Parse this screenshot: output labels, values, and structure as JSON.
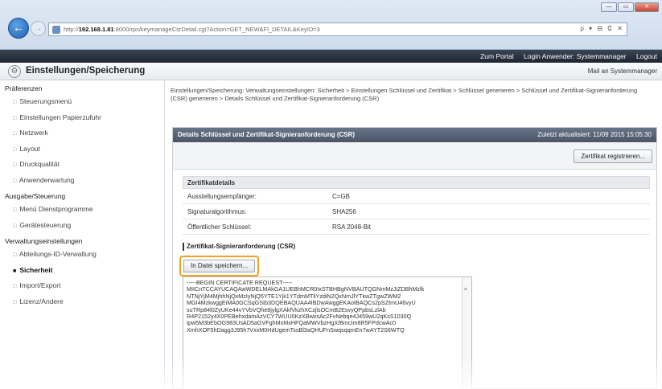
{
  "browser": {
    "url_prefix": "http://",
    "url_host": "192.168.1.81",
    "url_rest": ":8000/rps/keymanageCsrDetail.cgi?Action=GET_NEW&Fl_DETAIL&KeyID=3",
    "addr_tools": "ρ ▾ ⊟ ₵ ✕",
    "win_minimize": "—",
    "win_maximize": "▭",
    "win_close": "✕"
  },
  "portal": {
    "left_dim": "",
    "portal_link": "Zum Portal",
    "login_user": "Login Anwender: Systemmanager",
    "logout": "Logout"
  },
  "header": {
    "title": "Einstellungen/Speicherung",
    "mail": "Mail an Systemmanager"
  },
  "sidebar": {
    "groups": [
      {
        "title": "Präferenzen",
        "items": [
          {
            "label": "Steuerungsmenü"
          },
          {
            "label": "Einstellungen Papierzufuhr"
          },
          {
            "label": "Netzwerk"
          },
          {
            "label": "Layout"
          },
          {
            "label": "Druckqualität"
          },
          {
            "label": "Anwenderwartung"
          }
        ]
      },
      {
        "title": "Ausgabe/Steuerung",
        "items": [
          {
            "label": "Menü Dienstprogramme"
          },
          {
            "label": "Gerätesteuerung"
          }
        ]
      },
      {
        "title": "Verwaltungseinstellungen",
        "items": [
          {
            "label": "Abteilungs-ID-Verwaltung"
          },
          {
            "label": "Sicherheit"
          },
          {
            "label": "Import/Export"
          },
          {
            "label": "Lizenz/Andere"
          }
        ]
      }
    ]
  },
  "main": {
    "breadcrumb": "Einstellungen/Speicherung: Verwaltungseinstellungen: Sicherheit > Einstellungen Schlüssel und Zertifikat > Schlüssel generieren > Schlüssel und Zertifikat-Signieranforderung (CSR) generieren > Details Schlüssel und Zertifikat-Signieranforderung (CSR)",
    "panel_title": "Details Schlüssel und Zertifikat-Signieranforderung (CSR)",
    "last_updated": "Zuletzt aktualisiert: 11/09 2015 15:05:30",
    "register_button": "Zertifikat registrieren...",
    "details_title": "Zertifikatdetails",
    "details": [
      {
        "key": "Ausstellungsempfänger:",
        "value": "C=GB"
      },
      {
        "key": "Signaturalgorithmus:",
        "value": "SHA256"
      },
      {
        "key": "Öffentlicher Schlüssel:",
        "value": "RSA 2048-Bit"
      }
    ],
    "csr_title": "Zertifikat-Signieranforderung (CSR)",
    "save_button": "In Datei speichern...",
    "csr_text": "-----BEGIN CERTIFICATE REQUEST-----\nMIICnTCCAYUCAQAwWDELMAkGA1UEBhMCR0IxSTBHBgNVBAUTQGNmMzJiZDBhMzlk\nNTNjYjM4MjhhNjQxMzIyNjQ5YTE1Yjk1YTdmMTliYzdiN2QxNmJlYTkwZTgwZWM2\nMGI4MzkwggEiMA0GCSqGSIb3DQEBAQUAA4IBDwAwggEKAoIBAQCs2pSZtmU46vyU\nsuTRp84l0ZyUKe44vYVbVQhe8jylgXAkfVkzhXCzjlsOCmB2EsvyQPpbsLzlAb\nR4P2152y4X0PEBehxdamAzVCY7WUU0KzXBwvsAc2FvNebqe4J459wU2qKsS1030Q\nIpw5M3bEbOG983UsAD5aGVFghMxMxHFQaMWVbzHgX/BmcIm8R5FPdcwAc0\nXmhXOF5hDagg3J95h7VxxM0HdUgemTssBl3aQHUFnSwqsqqmEn7wAYT2S6WTQ"
  }
}
